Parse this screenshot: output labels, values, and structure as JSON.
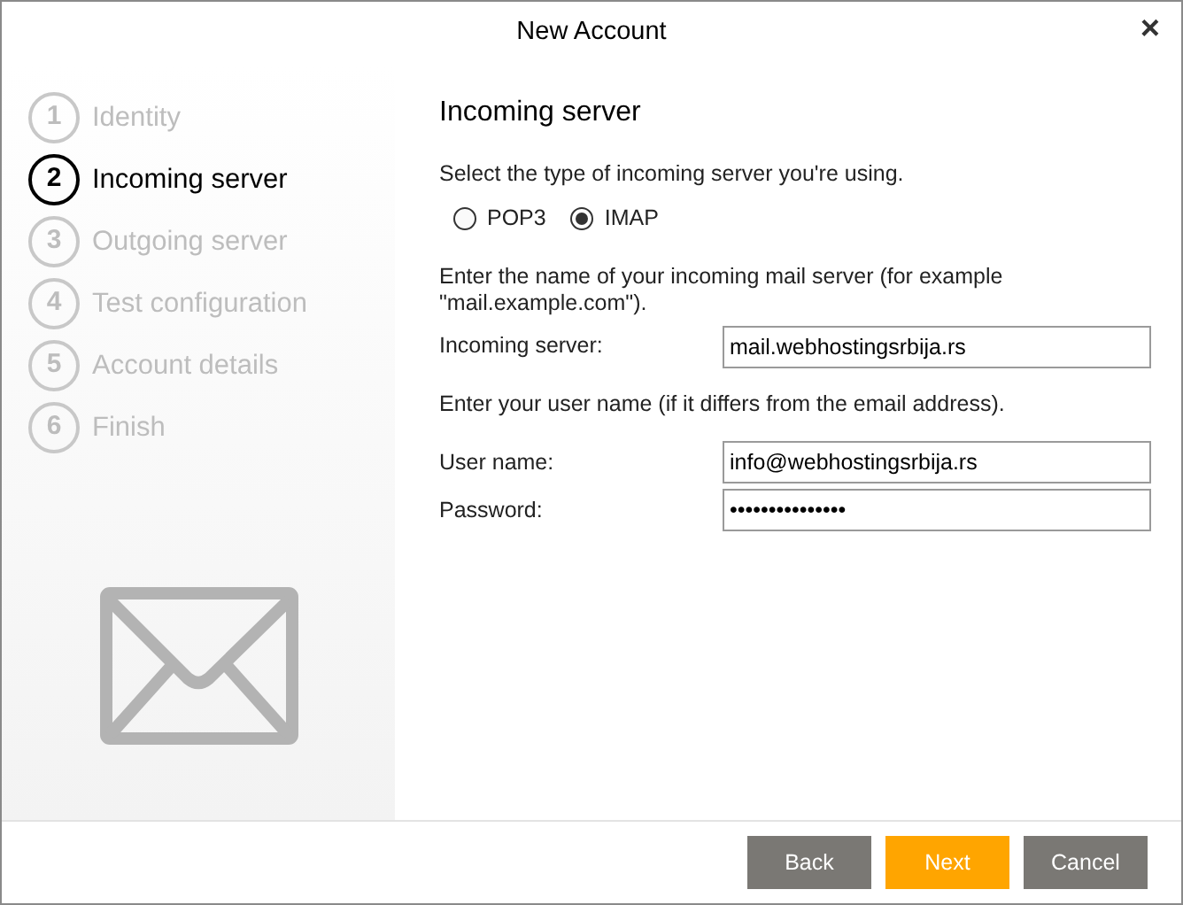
{
  "window": {
    "title": "New Account",
    "close": "×"
  },
  "steps": [
    {
      "number": "1",
      "label": "Identity",
      "selected": false
    },
    {
      "number": "2",
      "label": "Incoming server",
      "selected": true
    },
    {
      "number": "3",
      "label": "Outgoing server",
      "selected": false
    },
    {
      "number": "4",
      "label": "Test configuration",
      "selected": false
    },
    {
      "number": "5",
      "label": "Account details",
      "selected": false
    },
    {
      "number": "6",
      "label": "Finish",
      "selected": false
    }
  ],
  "heading": "Incoming server",
  "server_type": {
    "prompt": "Select the type of incoming server you're using.",
    "options": [
      {
        "label": "POP3",
        "selected": false
      },
      {
        "label": "IMAP",
        "selected": true
      }
    ]
  },
  "server_hint": "Enter the name of your incoming mail server (for example \"mail.example.com\").",
  "incoming_server": {
    "label": "Incoming server:",
    "value": "mail.webhostingsrbija.rs"
  },
  "user_hint": "Enter your user name (if it differs from the email address).",
  "user_name": {
    "label": "User name:",
    "value": "info@webhostingsrbija.rs"
  },
  "password": {
    "label": "Password:",
    "value": "•••••••••••••••"
  },
  "buttons": [
    {
      "label": "Back",
      "kind": "secondary"
    },
    {
      "label": "Next",
      "kind": "primary"
    },
    {
      "label": "Cancel",
      "kind": "secondary"
    }
  ]
}
